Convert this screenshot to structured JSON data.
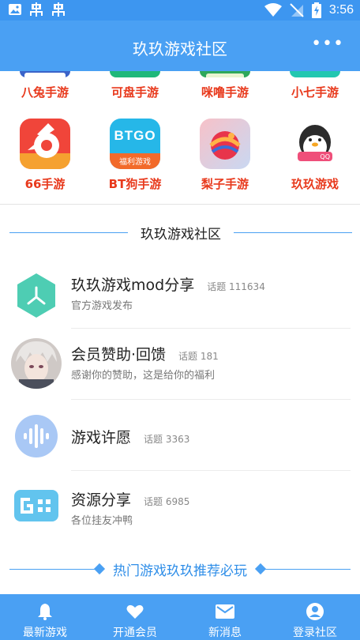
{
  "status_bar": {
    "time": "3:56",
    "left_icons": [
      "image-icon",
      "bug-icon",
      "bug-icon"
    ],
    "right_icons": [
      "wifi-icon",
      "signal-off-icon",
      "battery-charging-icon"
    ]
  },
  "header": {
    "title": "玖玖游戏社区",
    "more_label": "•••"
  },
  "apps_row1": [
    {
      "label": "八兔手游",
      "icon": "bagu-app-icon",
      "color": "#f04a2a"
    },
    {
      "label": "可盘手游",
      "icon": "kepan-app-icon",
      "color": "#1fb87a"
    },
    {
      "label": "咪噜手游",
      "icon": "milu-app-icon",
      "color": "#2ea85a"
    },
    {
      "label": "小七手游",
      "icon": "xiaoqi-app-icon",
      "color": "#22c7b0"
    }
  ],
  "apps_row2": [
    {
      "label": "66手游",
      "icon": "66-app-icon",
      "color": "#f0453a"
    },
    {
      "label": "BT狗手游",
      "icon": "btgou-app-icon",
      "color": "#26b7e8",
      "badge": "BTGO",
      "sub": "福利游戏"
    },
    {
      "label": "梨子手游",
      "icon": "lizi-app-icon",
      "color": "#e85a6a"
    },
    {
      "label": "玖玖游戏",
      "icon": "penguin-app-icon",
      "color": "#ffffff",
      "sub": "QQ"
    }
  ],
  "section_title": "玖玖游戏社区",
  "topics": [
    {
      "name": "玖玖游戏mod分享",
      "count": "话题 111634",
      "desc": "官方游戏发布",
      "icon": "hexagon-logo-icon"
    },
    {
      "name": "会员赞助·回馈",
      "count": "话题 181",
      "desc": "感谢你的赞助，这是给你的福利",
      "icon": "anime-avatar-icon"
    },
    {
      "name": "游戏许愿",
      "count": "话题 3363",
      "desc": "",
      "icon": "soundwave-icon"
    },
    {
      "name": "资源分享",
      "count": "话题 6985",
      "desc": "各位挂友冲鸭",
      "icon": "game-g-icon"
    }
  ],
  "hot_title": "热门游戏玖玖推荐必玩",
  "bottom_nav": [
    {
      "label": "最新游戏",
      "icon": "bell-icon"
    },
    {
      "label": "开通会员",
      "icon": "heart-icon"
    },
    {
      "label": "新消息",
      "icon": "mail-icon"
    },
    {
      "label": "登录社区",
      "icon": "user-circle-icon"
    }
  ],
  "colors": {
    "primary": "#4aa0f3",
    "app_label": "#e8391c",
    "accent_text": "#2f8ee8"
  }
}
